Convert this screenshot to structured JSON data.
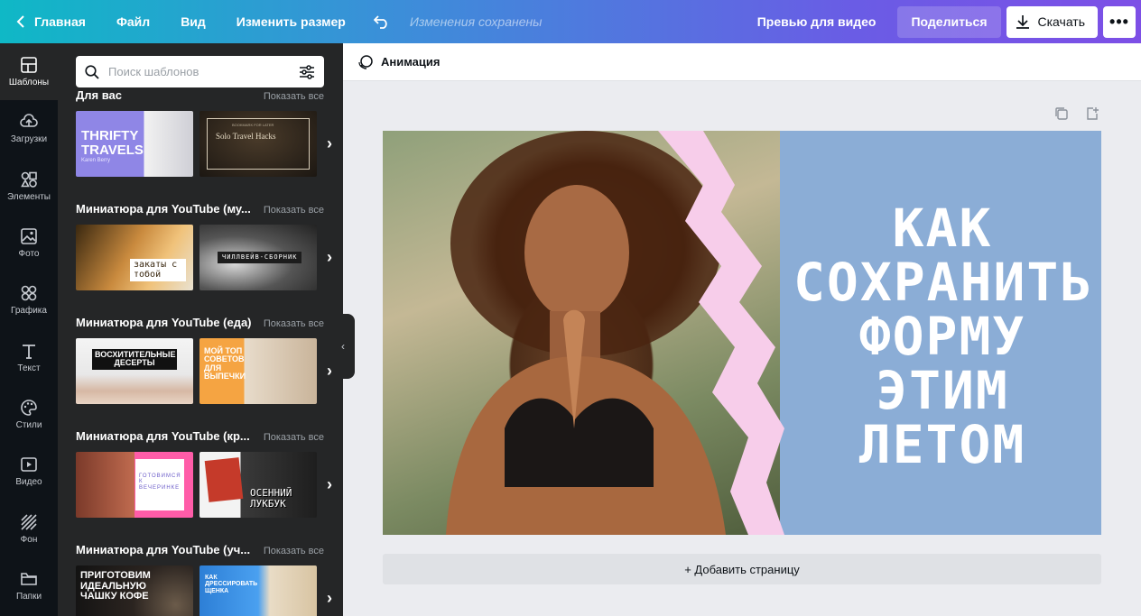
{
  "topbar": {
    "home": "Главная",
    "file": "Файл",
    "view": "Вид",
    "resize": "Изменить размер",
    "saved_status": "Изменения сохранены",
    "preview": "Превью для видео",
    "share": "Поделиться",
    "download": "Скачать"
  },
  "rail": [
    {
      "label": "Шаблоны",
      "icon": "templates-icon"
    },
    {
      "label": "Загрузки",
      "icon": "upload-icon"
    },
    {
      "label": "Элементы",
      "icon": "elements-icon"
    },
    {
      "label": "Фото",
      "icon": "photo-icon"
    },
    {
      "label": "Графика",
      "icon": "graphics-icon"
    },
    {
      "label": "Текст",
      "icon": "text-icon"
    },
    {
      "label": "Стили",
      "icon": "palette-icon"
    },
    {
      "label": "Видео",
      "icon": "video-icon"
    },
    {
      "label": "Фон",
      "icon": "background-icon"
    },
    {
      "label": "Папки",
      "icon": "folder-icon"
    }
  ],
  "panel": {
    "search_placeholder": "Поиск шаблонов",
    "sections": [
      {
        "title": "Для вас",
        "show_all": "Показать все",
        "thumbs": [
          {
            "caption": "THRIFTY TRAVELS",
            "sub": "Karen Berry"
          },
          {
            "caption": "Solo Travel Hacks",
            "sub": "BOOKMARK FOR LATER"
          }
        ]
      },
      {
        "title": "Миниатюра для YouTube (му...",
        "show_all": "Показать все",
        "thumbs": [
          {
            "caption": "закаты с тобой"
          },
          {
            "caption": "ЧИЛЛВЕЙВ-СБОРНИК"
          }
        ]
      },
      {
        "title": "Миниатюра для YouTube (еда)",
        "show_all": "Показать все",
        "thumbs": [
          {
            "caption": "ВОСХИТИТЕЛЬНЫЕ ДЕСЕРТЫ"
          },
          {
            "caption": "МОЙ ТОП СОВЕТОВ ДЛЯ ВЫПЕЧКИ"
          }
        ]
      },
      {
        "title": "Миниатюра для YouTube (кр...",
        "show_all": "Показать все",
        "thumbs": [
          {
            "caption": "ГОТОВИМСЯ К ВЕЧЕРИНКЕ"
          },
          {
            "caption": "ОСЕННИЙ ЛУКБУК"
          }
        ]
      },
      {
        "title": "Миниатюра для YouTube (уч...",
        "show_all": "Показать все",
        "thumbs": [
          {
            "caption": "ПРИГОТОВИМ ИДЕАЛЬНУЮ ЧАШКУ КОФЕ"
          },
          {
            "caption": "КАК ДРЕССИРОВАТЬ ЩЕНКА"
          }
        ]
      }
    ]
  },
  "editor": {
    "animation": "Анимация",
    "headline": [
      "КАК",
      "СОХРАНИТЬ",
      "ФОРМУ",
      "ЭТИМ",
      "ЛЕТОМ"
    ],
    "add_page": "+ Добавить страницу"
  },
  "colors": {
    "canvas_bg": "#8badd6",
    "brush": "#f7cdea",
    "rail_bg": "#0e1318",
    "panel_bg": "#252627"
  }
}
